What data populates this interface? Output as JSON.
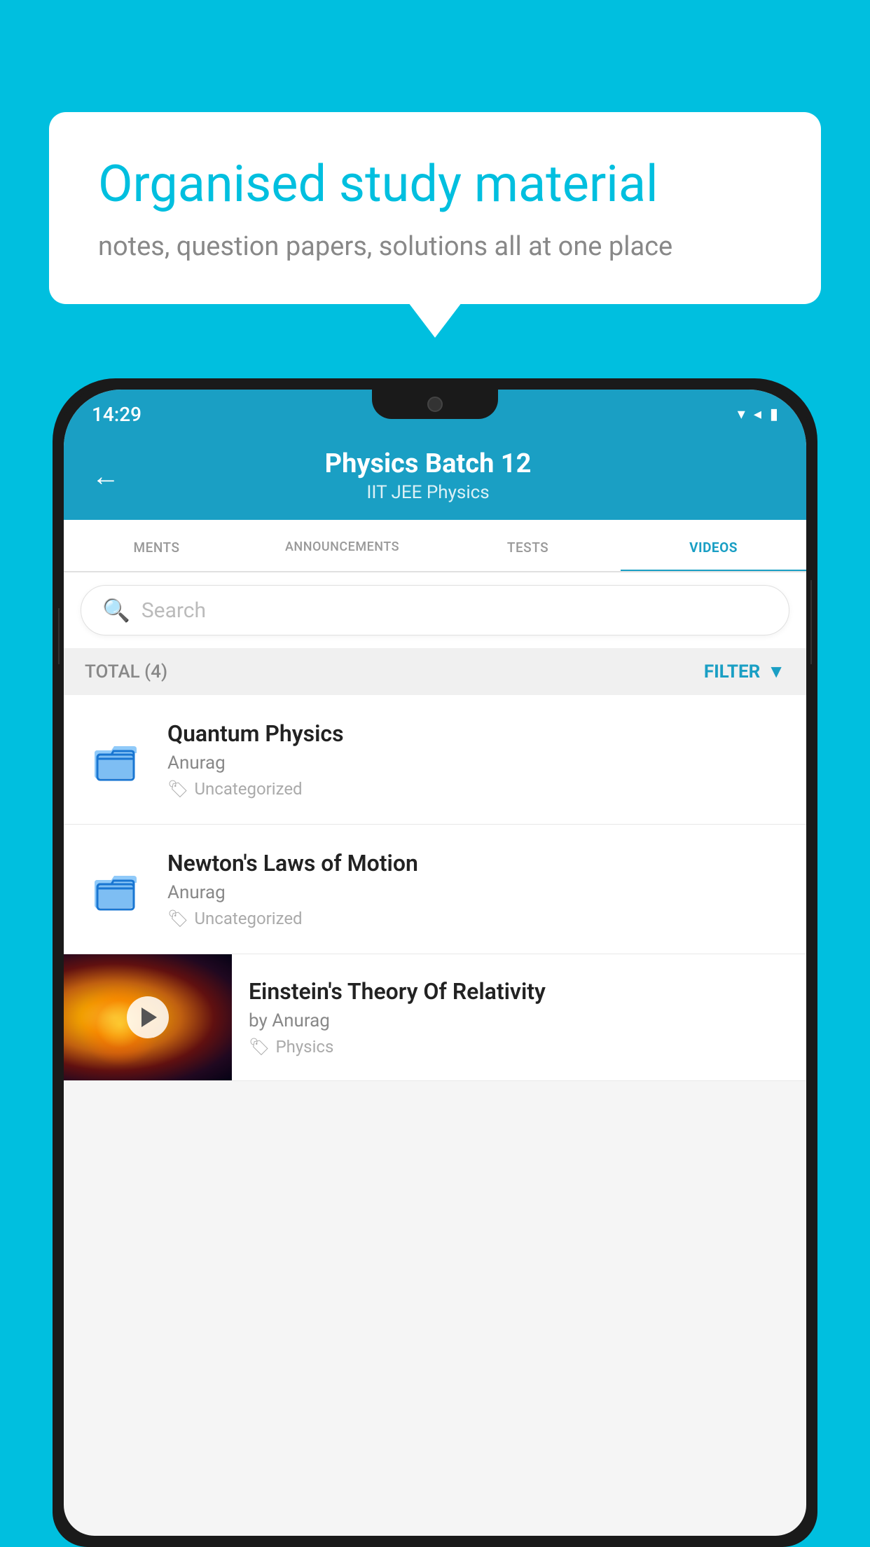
{
  "background_color": "#00BFDF",
  "bubble": {
    "title": "Organised study material",
    "subtitle": "notes, question papers, solutions all at one place"
  },
  "status_bar": {
    "time": "14:29",
    "wifi": "▾",
    "signal": "▾",
    "battery": "▮"
  },
  "header": {
    "title": "Physics Batch 12",
    "subtitle": "IIT JEE   Physics",
    "back_label": "←"
  },
  "tabs": [
    {
      "label": "MENTS",
      "active": false
    },
    {
      "label": "ANNOUNCEMENTS",
      "active": false
    },
    {
      "label": "TESTS",
      "active": false
    },
    {
      "label": "VIDEOS",
      "active": true
    }
  ],
  "search": {
    "placeholder": "Search"
  },
  "filter_bar": {
    "total_label": "TOTAL (4)",
    "filter_label": "FILTER"
  },
  "list_items": [
    {
      "id": 1,
      "title": "Quantum Physics",
      "author": "Anurag",
      "tag": "Uncategorized",
      "type": "folder"
    },
    {
      "id": 2,
      "title": "Newton's Laws of Motion",
      "author": "Anurag",
      "tag": "Uncategorized",
      "type": "folder"
    }
  ],
  "video_item": {
    "title": "Einstein's Theory Of Relativity",
    "author": "by Anurag",
    "tag": "Physics",
    "type": "video"
  }
}
